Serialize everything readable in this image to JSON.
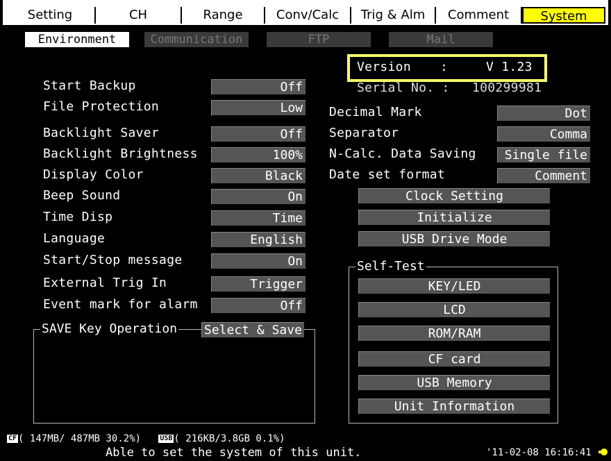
{
  "tabs": [
    "Setting",
    "CH",
    "Range",
    "Conv/Calc",
    "Trig & Alm",
    "Comment",
    "System"
  ],
  "subtabs": [
    "Environment",
    "Communication",
    "FTP",
    "Mail"
  ],
  "version": {
    "label": "Version",
    "sep": ":",
    "value": "V 1.23"
  },
  "serial": {
    "label": "Serial No. :",
    "value": "100299981"
  },
  "left_settings": [
    {
      "label": "Start Backup",
      "value": "Off"
    },
    {
      "label": "File Protection",
      "value": "Low"
    },
    {
      "label": "Backlight Saver",
      "value": "Off"
    },
    {
      "label": "Backlight Brightness",
      "value": "100%"
    },
    {
      "label": "Display Color",
      "value": "Black"
    },
    {
      "label": "Beep Sound",
      "value": "On"
    },
    {
      "label": "Time Disp",
      "value": "Time"
    },
    {
      "label": "Language",
      "value": "English"
    },
    {
      "label": "Start/Stop message",
      "value": "On"
    },
    {
      "label": "External Trig In",
      "value": "Trigger"
    },
    {
      "label": "Event mark for alarm",
      "value": "Off"
    }
  ],
  "save_key": {
    "label": "SAVE Key Operation",
    "value": "Select & Save"
  },
  "right_settings": [
    {
      "label": "Decimal Mark",
      "value": "Dot"
    },
    {
      "label": "Separator",
      "value": "Comma"
    },
    {
      "label": "N-Calc. Data Saving",
      "value": "Single file"
    },
    {
      "label": "Date set format",
      "value": "Comment"
    }
  ],
  "buttons": [
    "Clock Setting",
    "Initialize",
    "USB Drive Mode"
  ],
  "self_test": {
    "label": "Self-Test",
    "buttons": [
      "KEY/LED",
      "LCD",
      "ROM/RAM",
      "CF card",
      "USB Memory",
      "Unit Information"
    ]
  },
  "status": {
    "cf_badge": "CF",
    "cf_text": "( 147MB/ 487MB 30.2%)",
    "usb_badge": "USB",
    "usb_text": "( 216KB/3.8GB  0.1%)",
    "message": "Able to set the system of this unit.",
    "datetime": "'11-02-08 16:16:41"
  },
  "colors": {
    "highlight": "#ffff00",
    "button_bg": "#555555",
    "background": "#000000"
  }
}
